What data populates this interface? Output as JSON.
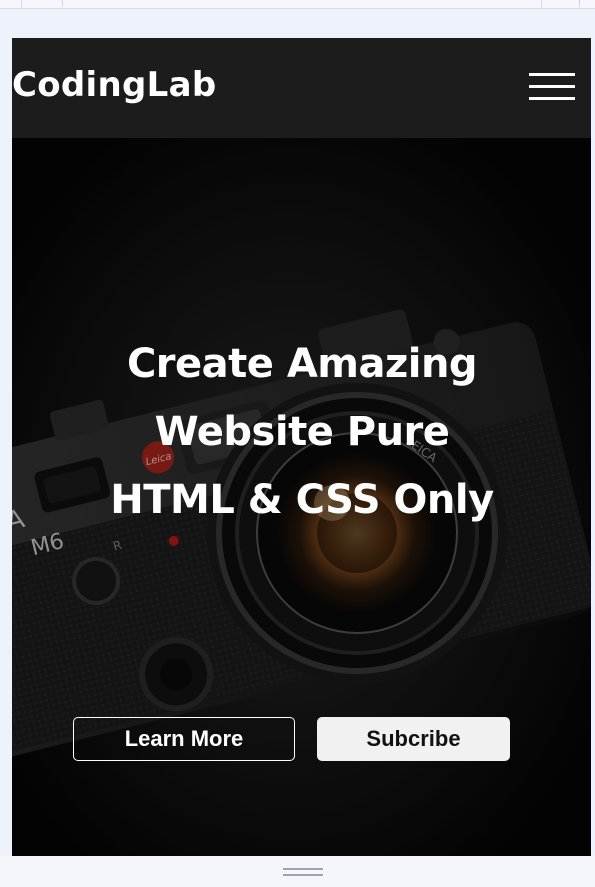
{
  "brand": {
    "logo_text": "CodingLab"
  },
  "nav": {
    "menu_icon": "hamburger-menu-icon"
  },
  "hero": {
    "headline": "Create Amazing Website Pure HTML & CSS Only",
    "background_image": "camera-photo",
    "camera_label_1": "EICA",
    "camera_label_2": "M6",
    "camera_label_3": "R",
    "lens_label": "LEICA",
    "primary_button": "Learn More",
    "secondary_button": "Subcribe"
  },
  "colors": {
    "navbar_bg": "#1c1c1c",
    "hero_overlay": "#000000",
    "text": "#ffffff",
    "secondary_button_bg": "#f1f1f1",
    "page_bg": "#eef2fb"
  }
}
